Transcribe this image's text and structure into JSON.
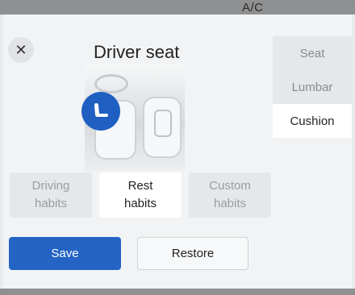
{
  "topbar": {
    "label": "A/C"
  },
  "header": {
    "title": "Driver seat",
    "close_icon": "close-icon"
  },
  "side_menu": {
    "items": [
      {
        "label": "Seat",
        "active": false
      },
      {
        "label": "Lumbar",
        "active": false
      },
      {
        "label": "Cushion",
        "active": true
      }
    ]
  },
  "habits": {
    "items": [
      {
        "label": "Driving\nhabits",
        "active": false
      },
      {
        "label": "Rest\nhabits",
        "active": true
      },
      {
        "label": "Custom\nhabits",
        "active": false
      }
    ]
  },
  "actions": {
    "save_label": "Save",
    "restore_label": "Restore"
  },
  "colors": {
    "accent": "#2364c4",
    "badge": "#1f5fc2"
  }
}
